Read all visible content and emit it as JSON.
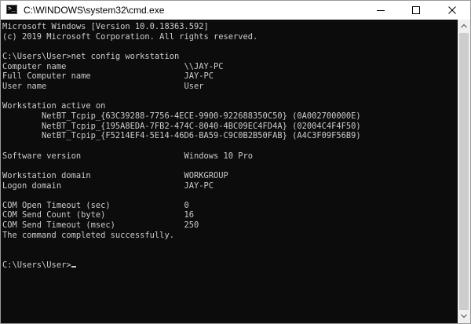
{
  "window": {
    "title": "C:\\WINDOWS\\system32\\cmd.exe",
    "icon": "cmd-icon"
  },
  "controls": {
    "minimize_icon": "minimize-icon",
    "maximize_icon": "maximize-icon",
    "close_icon": "close-icon"
  },
  "console": {
    "lines": [
      "Microsoft Windows [Version 10.0.18363.592]",
      "(c) 2019 Microsoft Corporation. All rights reserved.",
      "",
      "C:\\Users\\User>net config workstation",
      "Computer name                        \\\\JAY-PC",
      "Full Computer name                   JAY-PC",
      "User name                            User",
      "",
      "Workstation active on",
      "        NetBT_Tcpip_{63C39288-7756-4ECE-9900-922688350C50} (0A002700000E)",
      "        NetBT_Tcpip_{195A8EDA-7FB2-474C-8040-4BC09EC4FD4A} (02004C4F4F50)",
      "        NetBT_Tcpip_{F5214EF4-5E14-46D6-BA59-C9C0B2B50FAB} (A4C3F09F56B9)",
      "",
      "Software version                     Windows 10 Pro",
      "",
      "Workstation domain                   WORKGROUP",
      "Logon domain                         JAY-PC",
      "",
      "COM Open Timeout (sec)               0",
      "COM Send Count (byte)                16",
      "COM Send Timeout (msec)              250",
      "The command completed successfully.",
      "",
      "",
      "C:\\Users\\User>"
    ]
  },
  "colors": {
    "console_background": "#0c0c0c",
    "console_text": "#cccccc",
    "titlebar": "#ffffff",
    "scrollbar_track": "#f0f0f0",
    "scrollbar_thumb": "#cdcdcd"
  }
}
